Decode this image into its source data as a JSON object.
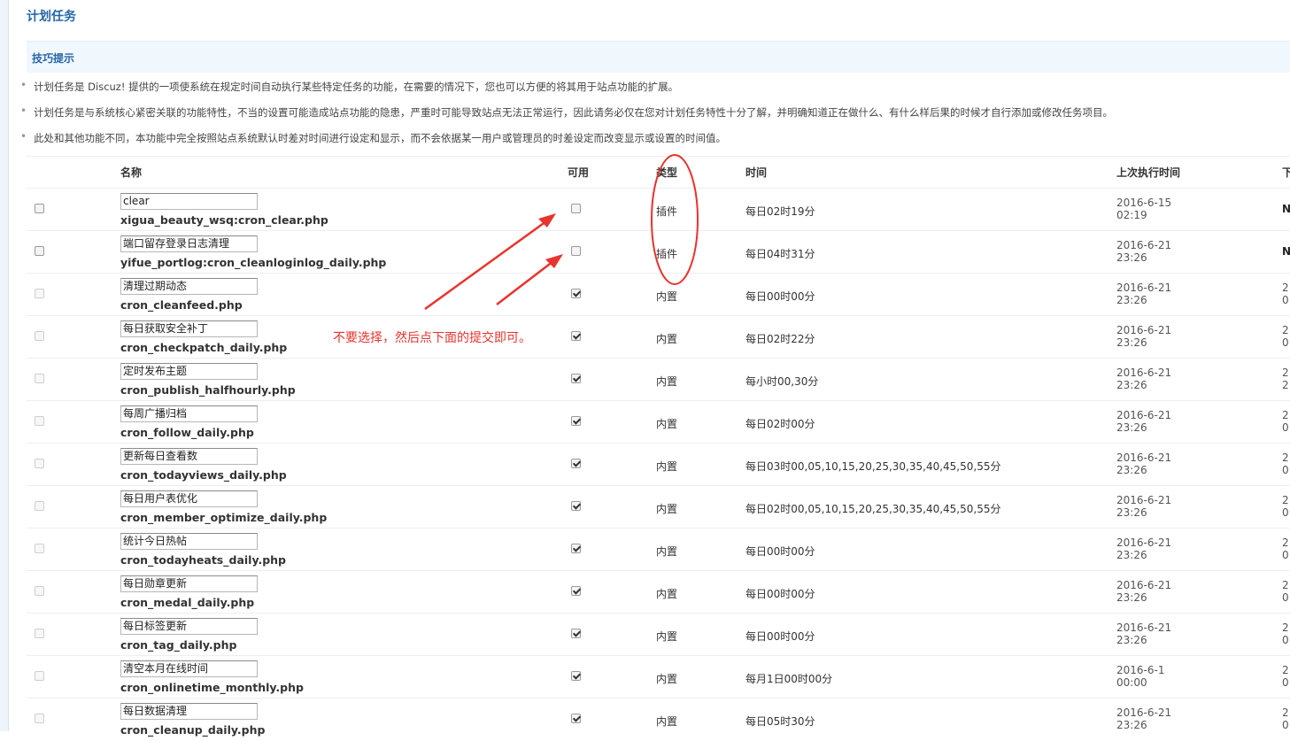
{
  "page_title": "计划任务",
  "tips": {
    "title": "技巧提示",
    "items": [
      "计划任务是 Discuz! 提供的一项使系统在规定时间自动执行某些特定任务的功能，在需要的情况下，您也可以方便的将其用于站点功能的扩展。",
      "计划任务是与系统核心紧密关联的功能特性，不当的设置可能造成站点功能的隐患，严重时可能导致站点无法正常运行，因此请务必仅在您对计划任务特性十分了解，并明确知道正在做什么、有什么样后果的时候才自行添加或修改任务项目。",
      "此处和其他功能不同，本功能中完全按照站点系统默认时差对时间进行设定和显示，而不会依据某一用户或管理员的时差设定而改变显示或设置的时间值。"
    ]
  },
  "columns": {
    "name": "名称",
    "available": "可用",
    "type": "类型",
    "time": "时间",
    "last_run": "上次执行时间",
    "next_run": "下"
  },
  "annotation": "不要选择，然后点下面的提交即可。",
  "colors": {
    "annotation": "#e8332e",
    "title": "#2366a8"
  },
  "rows": [
    {
      "name": "clear",
      "file": "xigua_beauty_wsq:cron_clear.php",
      "available": false,
      "select_enabled": true,
      "type": "插件",
      "time": "每日02时19分",
      "last_date": "2016-6-15",
      "last_time": "02:19",
      "next_a": "N",
      "next_b": ""
    },
    {
      "name": "端口留存登录日志清理",
      "file": "yifue_portlog:cron_cleanloginlog_daily.php",
      "available": false,
      "select_enabled": true,
      "type": "插件",
      "time": "每日04时31分",
      "last_date": "2016-6-21",
      "last_time": "23:26",
      "next_a": "N",
      "next_b": ""
    },
    {
      "name": "清理过期动态",
      "file": "cron_cleanfeed.php",
      "available": true,
      "select_enabled": false,
      "type": "内置",
      "time": "每日00时00分",
      "last_date": "2016-6-21",
      "last_time": "23:26",
      "next_a": "2",
      "next_b": "0"
    },
    {
      "name": "每日获取安全补丁",
      "file": "cron_checkpatch_daily.php",
      "available": true,
      "select_enabled": false,
      "type": "内置",
      "time": "每日02时22分",
      "last_date": "2016-6-21",
      "last_time": "23:26",
      "next_a": "2",
      "next_b": "0"
    },
    {
      "name": "定时发布主题",
      "file": "cron_publish_halfhourly.php",
      "available": true,
      "select_enabled": false,
      "type": "内置",
      "time": "每小时00,30分",
      "last_date": "2016-6-21",
      "last_time": "23:26",
      "next_a": "2",
      "next_b": "2"
    },
    {
      "name": "每周广播归档",
      "file": "cron_follow_daily.php",
      "available": true,
      "select_enabled": false,
      "type": "内置",
      "time": "每日02时00分",
      "last_date": "2016-6-21",
      "last_time": "23:26",
      "next_a": "2",
      "next_b": "0"
    },
    {
      "name": "更新每日查看数",
      "file": "cron_todayviews_daily.php",
      "available": true,
      "select_enabled": false,
      "type": "内置",
      "time": "每日03时00,05,10,15,20,25,30,35,40,45,50,55分",
      "last_date": "2016-6-21",
      "last_time": "23:26",
      "next_a": "2",
      "next_b": "0"
    },
    {
      "name": "每日用户表优化",
      "file": "cron_member_optimize_daily.php",
      "available": true,
      "select_enabled": false,
      "type": "内置",
      "time": "每日02时00,05,10,15,20,25,30,35,40,45,50,55分",
      "last_date": "2016-6-21",
      "last_time": "23:26",
      "next_a": "2",
      "next_b": "0"
    },
    {
      "name": "统计今日热帖",
      "file": "cron_todayheats_daily.php",
      "available": true,
      "select_enabled": false,
      "type": "内置",
      "time": "每日00时00分",
      "last_date": "2016-6-21",
      "last_time": "23:26",
      "next_a": "2",
      "next_b": "0"
    },
    {
      "name": "每日勋章更新",
      "file": "cron_medal_daily.php",
      "available": true,
      "select_enabled": false,
      "type": "内置",
      "time": "每日00时00分",
      "last_date": "2016-6-21",
      "last_time": "23:26",
      "next_a": "2",
      "next_b": "0"
    },
    {
      "name": "每日标签更新",
      "file": "cron_tag_daily.php",
      "available": true,
      "select_enabled": false,
      "type": "内置",
      "time": "每日00时00分",
      "last_date": "2016-6-21",
      "last_time": "23:26",
      "next_a": "2",
      "next_b": "0"
    },
    {
      "name": "清空本月在线时间",
      "file": "cron_onlinetime_monthly.php",
      "available": true,
      "select_enabled": false,
      "type": "内置",
      "time": "每月1日00时00分",
      "last_date": "2016-6-1",
      "last_time": "00:00",
      "next_a": "2",
      "next_b": "0"
    },
    {
      "name": "每日数据清理",
      "file": "cron_cleanup_daily.php",
      "available": true,
      "select_enabled": false,
      "type": "内置",
      "time": "每日05时30分",
      "last_date": "2016-6-21",
      "last_time": "23:26",
      "next_a": "2",
      "next_b": "0"
    }
  ]
}
